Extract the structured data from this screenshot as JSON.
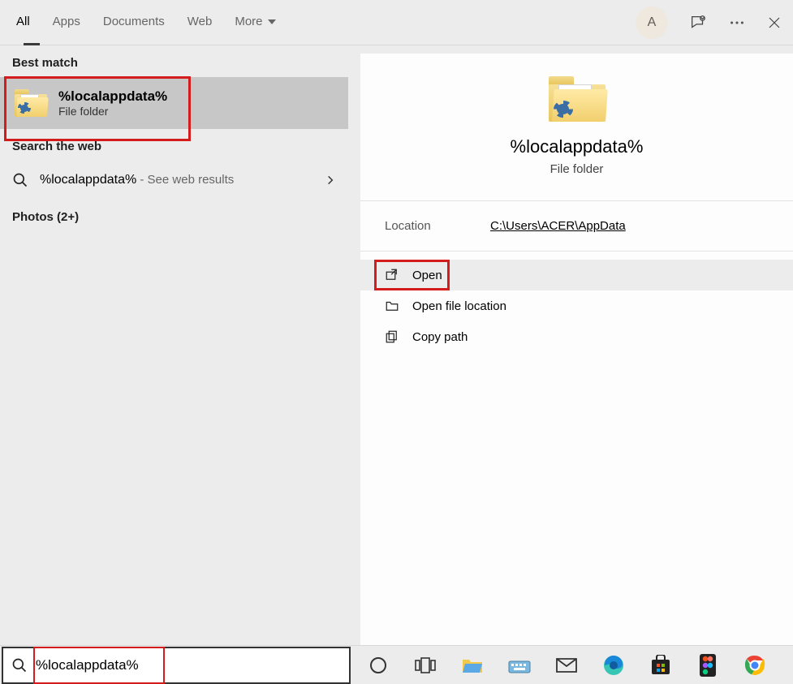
{
  "tabs": {
    "all": "All",
    "apps": "Apps",
    "documents": "Documents",
    "web": "Web",
    "more": "More"
  },
  "avatar_letter": "A",
  "sections": {
    "best_match": "Best match",
    "search_web": "Search the web",
    "photos": "Photos (2+)"
  },
  "best_match": {
    "title": "%localappdata%",
    "subtitle": "File folder"
  },
  "web_result": {
    "query": "%localappdata%",
    "suffix": " - See web results"
  },
  "preview": {
    "title": "%localappdata%",
    "subtitle": "File folder",
    "location_label": "Location",
    "location_path": "C:\\Users\\ACER\\AppData"
  },
  "actions": {
    "open": "Open",
    "open_location": "Open file location",
    "copy_path": "Copy path"
  },
  "search": {
    "value": "%localappdata%"
  }
}
